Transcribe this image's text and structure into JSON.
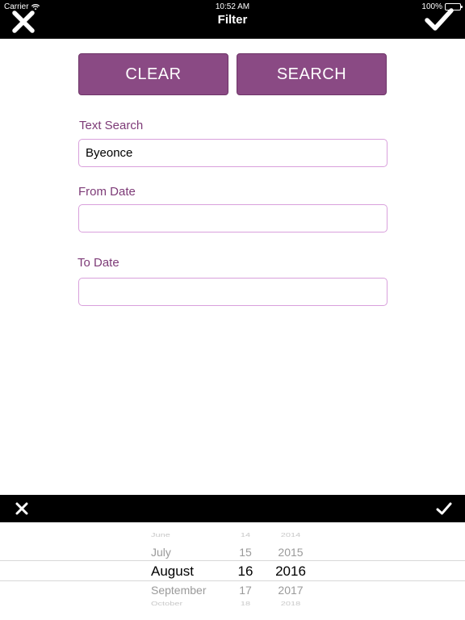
{
  "status_bar": {
    "carrier": "Carrier",
    "time": "10:52 AM",
    "battery": "100%"
  },
  "nav": {
    "title": "Filter",
    "close_icon": "close-x-icon",
    "done_icon": "checkmark-icon"
  },
  "buttons": {
    "clear": "CLEAR",
    "search": "SEARCH"
  },
  "form": {
    "text_search": {
      "label": "Text Search",
      "value": "Byeonce"
    },
    "from_date": {
      "label": "From Date",
      "value": ""
    },
    "to_date": {
      "label": "To Date",
      "value": ""
    }
  },
  "picker": {
    "months": [
      "June",
      "July",
      "August",
      "September",
      "October"
    ],
    "days": [
      "14",
      "15",
      "16",
      "17",
      "18"
    ],
    "years": [
      "2014",
      "2015",
      "2016",
      "2017",
      "2018"
    ],
    "selected": {
      "month": "August",
      "day": "16",
      "year": "2016"
    }
  },
  "colors": {
    "accent": "#8a4a84",
    "label": "#7d3a77",
    "field_border": "#d9a0dc",
    "bar": "#000000"
  }
}
